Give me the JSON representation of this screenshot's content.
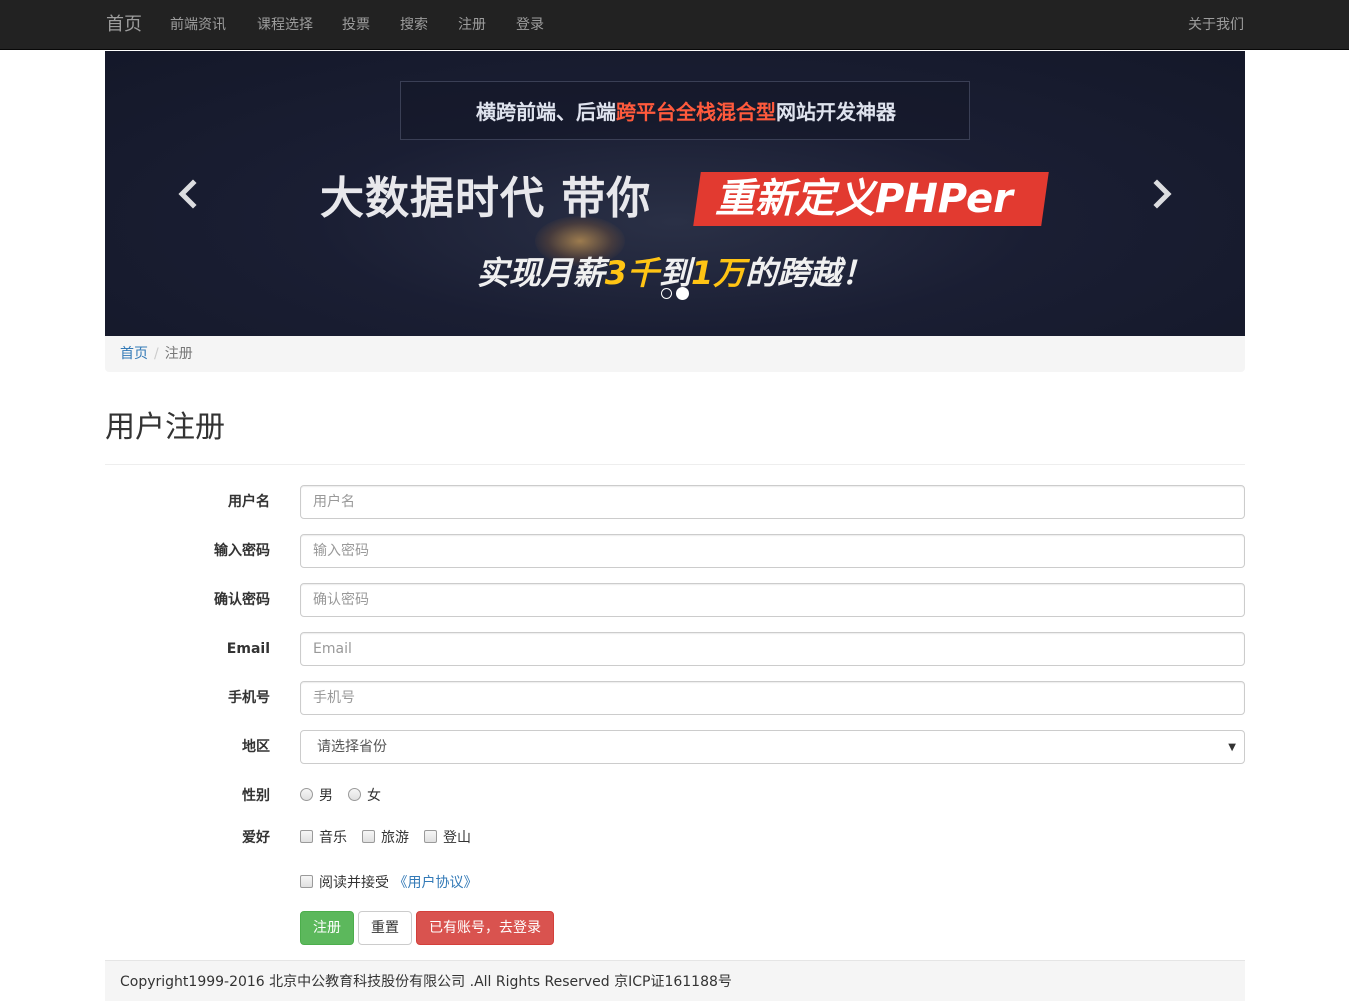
{
  "nav": {
    "brand": "首页",
    "links": [
      "前端资讯",
      "课程选择",
      "投票",
      "搜索",
      "注册",
      "登录"
    ],
    "right_link": "关于我们"
  },
  "carousel": {
    "top_text_prefix": "横跨前端、后端",
    "top_text_highlight": "跨平台全栈混合型",
    "top_text_suffix": "网站开发神器",
    "main_text": "大数据时代 带你",
    "main_highlight": "重新定义PHPer",
    "sub_text_1": "实现月薪",
    "sub_num_1": "3千",
    "sub_text_2": "到",
    "sub_num_2": "1万",
    "sub_text_3": "的跨越！",
    "slide_count": 2,
    "active_index": 1,
    "prev_icon": "chevron-left-icon",
    "next_icon": "chevron-right-icon"
  },
  "breadcrumb": {
    "home": "首页",
    "separator": "/",
    "current": "注册"
  },
  "page": {
    "title": "用户注册"
  },
  "form": {
    "username": {
      "label": "用户名",
      "placeholder": "用户名",
      "value": ""
    },
    "password": {
      "label": "输入密码",
      "placeholder": "输入密码",
      "value": ""
    },
    "confirm": {
      "label": "确认密码",
      "placeholder": "确认密码",
      "value": ""
    },
    "email": {
      "label": "Email",
      "placeholder": "Email",
      "value": ""
    },
    "phone": {
      "label": "手机号",
      "placeholder": "手机号",
      "value": ""
    },
    "region": {
      "label": "地区",
      "selected": "请选择省份"
    },
    "gender": {
      "label": "性别",
      "options": [
        "男",
        "女"
      ]
    },
    "hobby": {
      "label": "爱好",
      "options": [
        "音乐",
        "旅游",
        "登山"
      ]
    },
    "agree": {
      "text": "阅读并接受",
      "link": "《用户协议》"
    }
  },
  "buttons": {
    "register": "注册",
    "reset": "重置",
    "login": "已有账号，去登录"
  },
  "footer": {
    "text": "Copyright1999-2016 北京中公教育科技股份有限公司 .All Rights Reserved 京ICP证161188号"
  },
  "colors": {
    "navbar_bg": "#222222",
    "link": "#337ab7",
    "success": "#5cb85c",
    "danger": "#d9534f",
    "banner_red": "#e23a30",
    "banner_gold": "#ffc414"
  }
}
